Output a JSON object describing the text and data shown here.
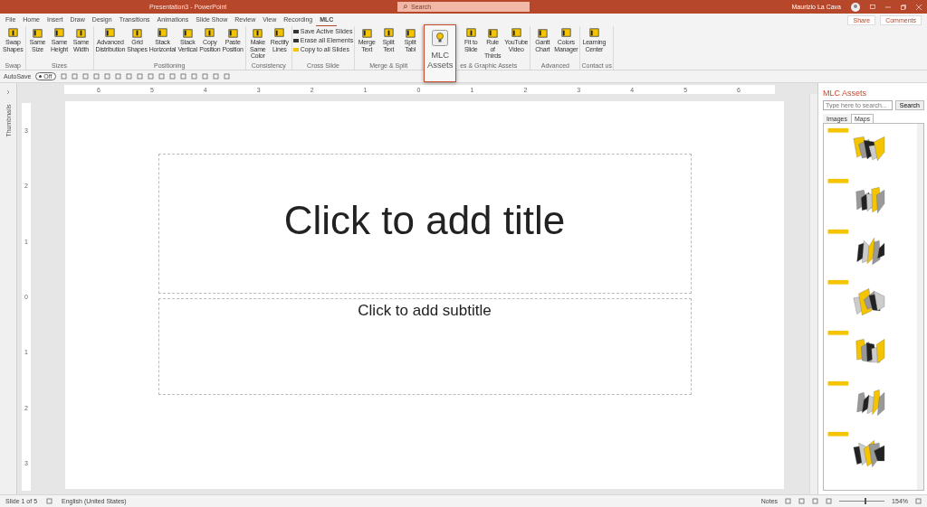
{
  "window": {
    "title": "Presentation3 - PowerPoint",
    "search_placeholder": "Search",
    "user": "Maurizio La Cava"
  },
  "tabs": [
    {
      "label": "File",
      "selected": false
    },
    {
      "label": "Home",
      "selected": false
    },
    {
      "label": "Insert",
      "selected": false
    },
    {
      "label": "Draw",
      "selected": false
    },
    {
      "label": "Design",
      "selected": false
    },
    {
      "label": "Transitions",
      "selected": false
    },
    {
      "label": "Animations",
      "selected": false
    },
    {
      "label": "Slide Show",
      "selected": false
    },
    {
      "label": "Review",
      "selected": false
    },
    {
      "label": "View",
      "selected": false
    },
    {
      "label": "Recording",
      "selected": false
    },
    {
      "label": "MLC",
      "selected": true
    }
  ],
  "share": "Share",
  "comments": "Comments",
  "ribbon": [
    {
      "label": "Swap",
      "kind": "buttons",
      "items": [
        "Swap Shapes"
      ]
    },
    {
      "label": "Sizes",
      "kind": "buttons",
      "items": [
        "Same Size",
        "Same Height",
        "Same Width"
      ]
    },
    {
      "label": "Positioning",
      "kind": "buttons",
      "items": [
        "Advanced Distribution",
        "Grid Shapes",
        "Stack Horizontal",
        "Stack Vertical",
        "Copy Position",
        "Paste Position"
      ]
    },
    {
      "label": "Consistency",
      "kind": "buttons",
      "items": [
        "Make Same Color",
        "Rectify Lines"
      ]
    },
    {
      "label": "Cross Slide",
      "kind": "list",
      "items": [
        "Save Active Slides",
        "Erase all Elements",
        "Copy to all Slides"
      ]
    },
    {
      "label": "Merge & Split",
      "kind": "buttons",
      "items": [
        "Merge Text",
        "Split Text",
        "Split Tabl"
      ]
    },
    {
      "label": "es & Graphic Assets",
      "kind": "covered",
      "items": [
        "Fit to Slide",
        "Rule of Thirds",
        "YouTube Video"
      ]
    },
    {
      "label": "Advanced",
      "kind": "buttons",
      "items": [
        "Gantt Chart",
        "Colors Manager"
      ]
    },
    {
      "label": "Contact us",
      "kind": "buttons",
      "items": [
        "Learning Center"
      ]
    }
  ],
  "popup_button": "MLC Assets",
  "autosave": {
    "label": "AutoSave",
    "on": false,
    "state": "Off"
  },
  "ruler": {
    "horizontal": [
      "6",
      "5",
      "4",
      "3",
      "2",
      "1",
      "0",
      "1",
      "2",
      "3",
      "4",
      "5",
      "6"
    ],
    "vertical": [
      "3",
      "2",
      "1",
      "0",
      "1",
      "2",
      "3"
    ]
  },
  "thumbnails_label": "Thumbnails",
  "slide": {
    "title": "Click to add title",
    "subtitle": "Click to add subtitle"
  },
  "panel": {
    "title": "MLC Assets",
    "search_placeholder": "Type here to search...",
    "search_button": "Search",
    "tabs": [
      {
        "label": "Images",
        "selected": false
      },
      {
        "label": "Maps",
        "selected": true
      }
    ]
  },
  "status": {
    "slide": "Slide 1 of 5",
    "language": "English (United States)",
    "notes": "Notes",
    "zoom": "154%",
    "zoom_level": {
      "level": 0.55
    }
  }
}
